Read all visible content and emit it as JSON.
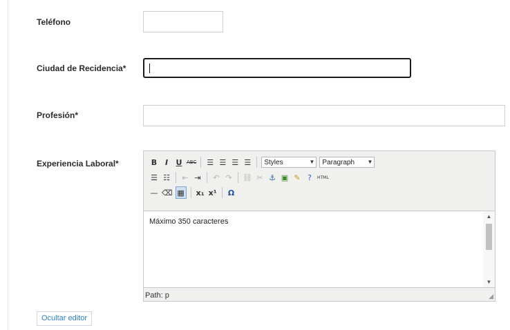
{
  "fields": {
    "telefono": {
      "label": "Teléfono",
      "value": ""
    },
    "ciudad": {
      "label": "Ciudad de Recidencia*",
      "value": ""
    },
    "profesion": {
      "label": "Profesión*",
      "value": ""
    },
    "experiencia": {
      "label": "Experiencia Laboral*"
    }
  },
  "editor": {
    "toolbar": {
      "styles_select": "Styles",
      "format_select": "Paragraph",
      "icons_row1": [
        "bold-icon",
        "italic-icon",
        "underline-icon",
        "strikethrough-icon",
        "align-left-icon",
        "align-center-icon",
        "align-right-icon",
        "align-justify-icon"
      ],
      "icons_row2": [
        "bullet-list-icon",
        "numbered-list-icon",
        "outdent-icon",
        "indent-icon",
        "undo-icon",
        "redo-icon",
        "link-icon",
        "unlink-icon",
        "anchor-icon",
        "image-icon",
        "cleanup-icon",
        "help-icon",
        "html-icon"
      ],
      "icons_row3": [
        "horizontal-rule-icon",
        "remove-format-icon",
        "visual-aid-icon",
        "subscript-icon",
        "superscript-icon",
        "special-char-icon"
      ],
      "labels": {
        "bold": "B",
        "italic": "I",
        "underline": "U",
        "strike": "ABC",
        "sub": "x₁",
        "sup": "x¹",
        "omega": "Ω",
        "html": "HTML"
      }
    },
    "content_text": "Máximo 350 caracteres",
    "path_text": "Path: p"
  },
  "buttons": {
    "toggle_editor": "Ocultar editor"
  },
  "colors": {
    "link_blue": "#2c7fc1",
    "focus_border": "#1a1a1a",
    "active_tool": "#cfe1f5"
  }
}
